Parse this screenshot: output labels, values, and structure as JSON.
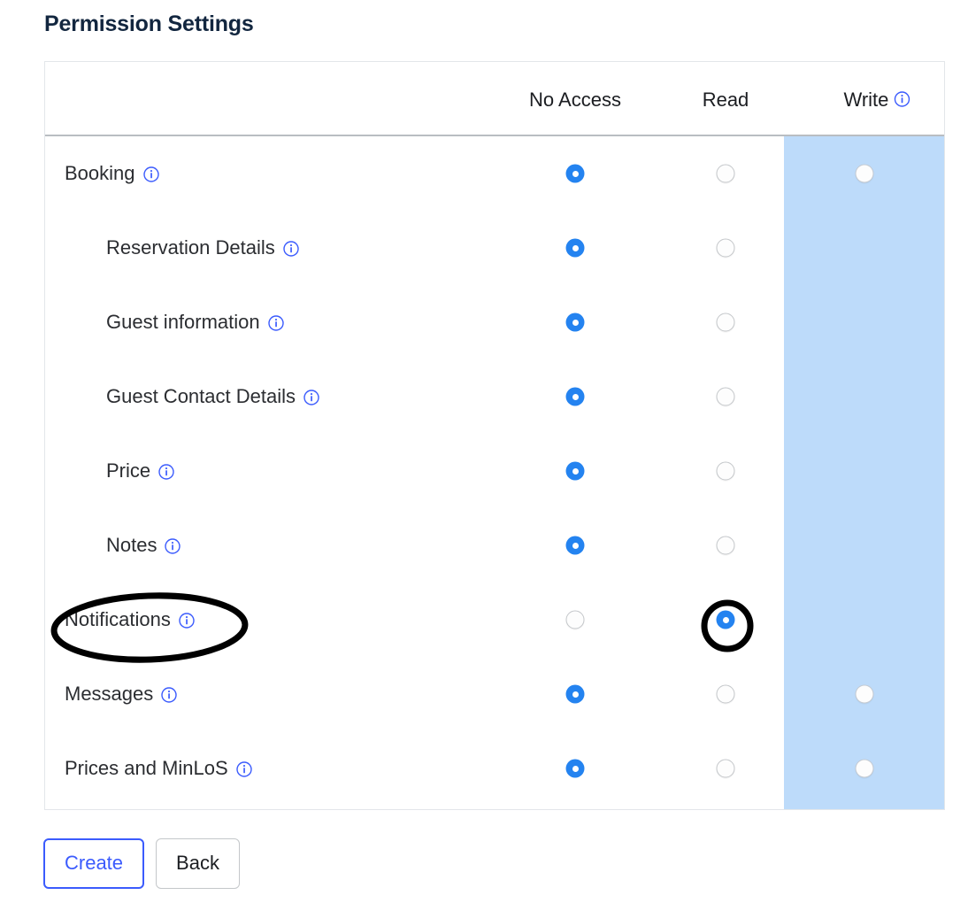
{
  "page": {
    "title": "Permission Settings"
  },
  "colors": {
    "title": "#12263f",
    "accent_blue": "#2483f0",
    "link_blue": "#3b5bfd",
    "highlight_column": "#bddbfa",
    "border": "#e3e6ea",
    "annotation": "#000000"
  },
  "table": {
    "columns": [
      {
        "key": "no_access",
        "label": "No Access",
        "info": false
      },
      {
        "key": "read",
        "label": "Read",
        "info": false
      },
      {
        "key": "write",
        "label": "Write",
        "info": true,
        "highlighted": true
      }
    ],
    "rows": [
      {
        "label": "Booking",
        "level": 0,
        "info": true,
        "selected": "no_access",
        "has_write": true,
        "annotated": false
      },
      {
        "label": "Reservation Details",
        "level": 1,
        "info": true,
        "selected": "no_access",
        "has_write": false,
        "annotated": false
      },
      {
        "label": "Guest information",
        "level": 1,
        "info": true,
        "selected": "no_access",
        "has_write": false,
        "annotated": false
      },
      {
        "label": "Guest Contact Details",
        "level": 1,
        "info": true,
        "selected": "no_access",
        "has_write": false,
        "annotated": false
      },
      {
        "label": "Price",
        "level": 1,
        "info": true,
        "selected": "no_access",
        "has_write": false,
        "annotated": false
      },
      {
        "label": "Notes",
        "level": 1,
        "info": true,
        "selected": "no_access",
        "has_write": false,
        "annotated": false
      },
      {
        "label": "Notifications",
        "level": 0,
        "info": true,
        "selected": "read",
        "has_write": false,
        "annotated": true
      },
      {
        "label": "Messages",
        "level": 0,
        "info": true,
        "selected": "no_access",
        "has_write": true,
        "annotated": false
      },
      {
        "label": "Prices and MinLoS",
        "level": 0,
        "info": true,
        "selected": "no_access",
        "has_write": true,
        "annotated": false
      }
    ]
  },
  "annotations": [
    {
      "name": "notifications-label-ellipse",
      "shape": "ellipse",
      "target": "Notifications"
    },
    {
      "name": "notifications-read-radio-circle",
      "shape": "circle",
      "target": "Notifications Read radio"
    }
  ],
  "footer": {
    "create_label": "Create",
    "back_label": "Back"
  },
  "icons": {
    "info": "info-icon"
  }
}
